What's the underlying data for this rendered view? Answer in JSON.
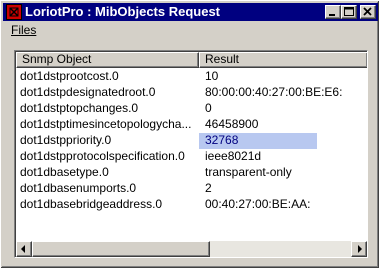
{
  "window": {
    "title": "LoriotPro : MibObjects Request",
    "icon": "loriotpro-app-icon",
    "controls": [
      "minimize-icon",
      "maximize-icon",
      "close-icon"
    ]
  },
  "menubar": {
    "files_label": "Files"
  },
  "list": {
    "columns": [
      "Snmp Object",
      "Result"
    ],
    "rows": [
      {
        "object": "dot1dstprootcost.0",
        "result": "10"
      },
      {
        "object": "dot1dstpdesignatedroot.0",
        "result": "80:00:00:40:27:00:BE:E6:"
      },
      {
        "object": "dot1dstptopchanges.0",
        "result": "0"
      },
      {
        "object": "dot1dstptimesincetopologycha...",
        "result": "46458900"
      },
      {
        "object": "dot1dstppriority.0",
        "result": "32768"
      },
      {
        "object": "dot1dstpprotocolspecification.0",
        "result": "ieee8021d"
      },
      {
        "object": "dot1dbasetype.0",
        "result": "transparent-only"
      },
      {
        "object": "dot1dbasenumports.0",
        "result": "2"
      },
      {
        "object": "dot1dbasebridgeaddress.0",
        "result": "00:40:27:00:BE:AA:"
      }
    ],
    "selected_row_index": 4
  },
  "colors": {
    "titlebar": "#000080",
    "selection_bg": "#b8c8f0",
    "selection_text": "#000080",
    "face": "#d4d0c8"
  }
}
